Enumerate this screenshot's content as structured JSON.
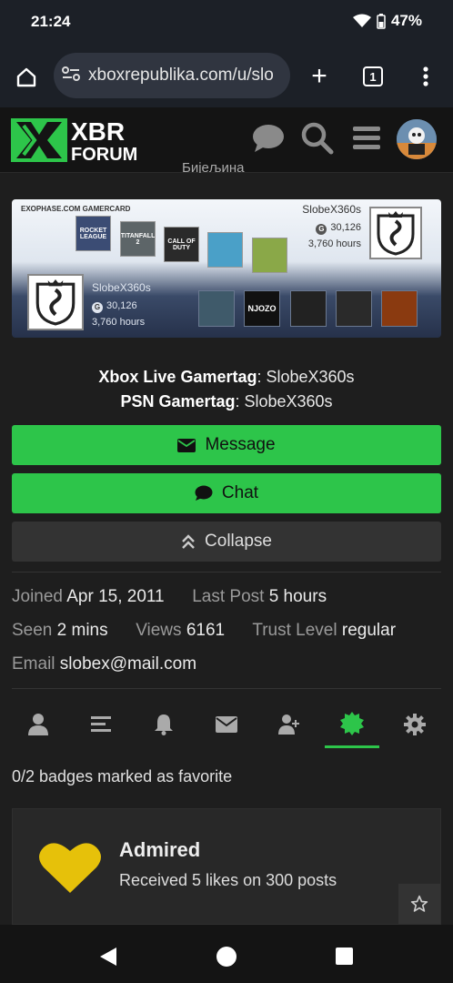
{
  "status_bar": {
    "time": "21:24",
    "battery": "47%"
  },
  "browser": {
    "url": "xboxrepublika.com/u/slo",
    "tab_count": "1"
  },
  "forum": {
    "logo_top": "XBR",
    "logo_bottom": "FORUM"
  },
  "cut_off_text": "Бијељина",
  "gamercard": {
    "header": "EXOPHASE.COM GAMERCARD",
    "name": "SlobeX360s",
    "points": "30,126",
    "hours": "3,760 hours",
    "games": [
      "ROCKET LEAGUE",
      "TITANFALL 2",
      "CALL OF DUTY",
      "",
      ""
    ],
    "badges": [
      "",
      "NJOZO",
      "",
      "",
      ""
    ]
  },
  "profile": {
    "xbox_label": "Xbox Live Gamertag",
    "xbox_value": ": SlobeX360s",
    "psn_label": "PSN Gamertag",
    "psn_value": ": SlobeX360s"
  },
  "buttons": {
    "message": "Message",
    "chat": "Chat",
    "collapse": "Collapse"
  },
  "meta": {
    "joined_label": "Joined",
    "joined_value": "Apr 15, 2011",
    "last_post_label": "Last Post",
    "last_post_value": "5 hours",
    "seen_label": "Seen",
    "seen_value": "2 mins",
    "views_label": "Views",
    "views_value": "6161",
    "trust_label": "Trust Level",
    "trust_value": "regular",
    "email_label": "Email",
    "email_value": "slobex@mail.com"
  },
  "tabs": [
    "summary-icon",
    "activity-icon",
    "notifications-icon",
    "messages-icon",
    "invite-icon",
    "badges-icon",
    "preferences-icon"
  ],
  "badges_section": {
    "favorite_text": "0/2 badges marked as favorite",
    "badge_title": "Admired",
    "badge_desc": "Received 5 likes on 300 posts"
  },
  "colors": {
    "accent": "#2dc54a",
    "badge_heart": "#e6c10a",
    "background": "#1e1e1e"
  }
}
